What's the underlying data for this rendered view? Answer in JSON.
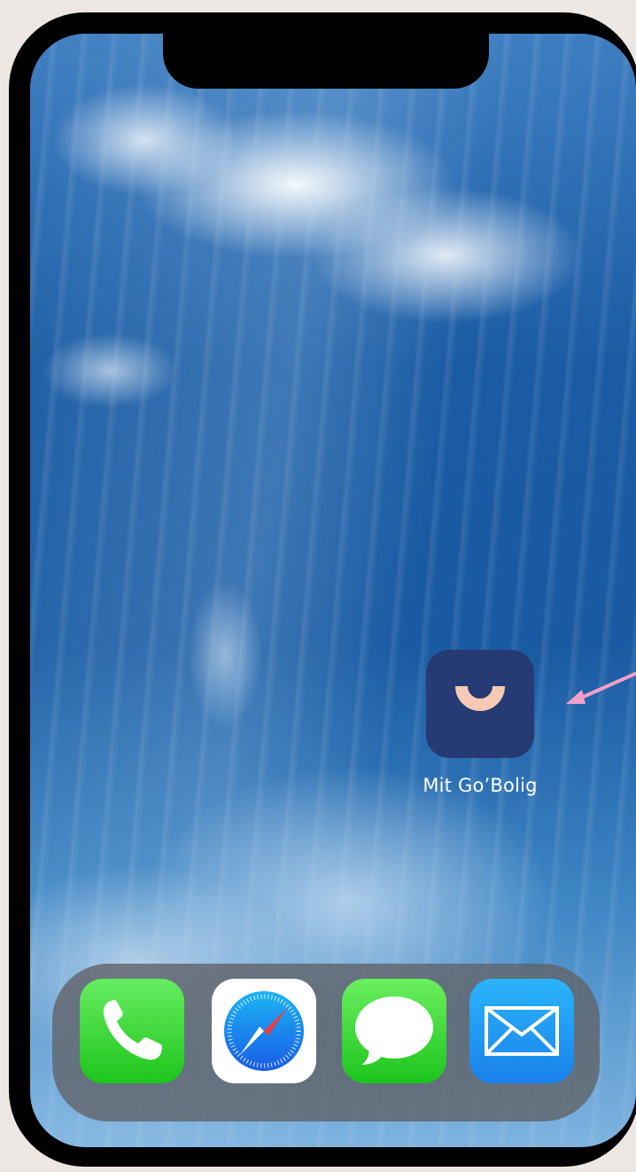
{
  "home_screen": {
    "apps": [
      {
        "label": "Mit Go’Bolig",
        "icon": "smile-icon",
        "bg_color": "#263a73",
        "accent_color": "#f7c9b4"
      }
    ],
    "dock": [
      {
        "icon": "phone-icon",
        "color": "#2ed12a"
      },
      {
        "icon": "safari-icon",
        "color": "#1c7ef0"
      },
      {
        "icon": "messages-icon",
        "color": "#2ed12a"
      },
      {
        "icon": "mail-icon",
        "color": "#1e9bf5"
      }
    ]
  },
  "annotation": {
    "icon": "arrow-icon",
    "color": "#f2a0c8"
  }
}
